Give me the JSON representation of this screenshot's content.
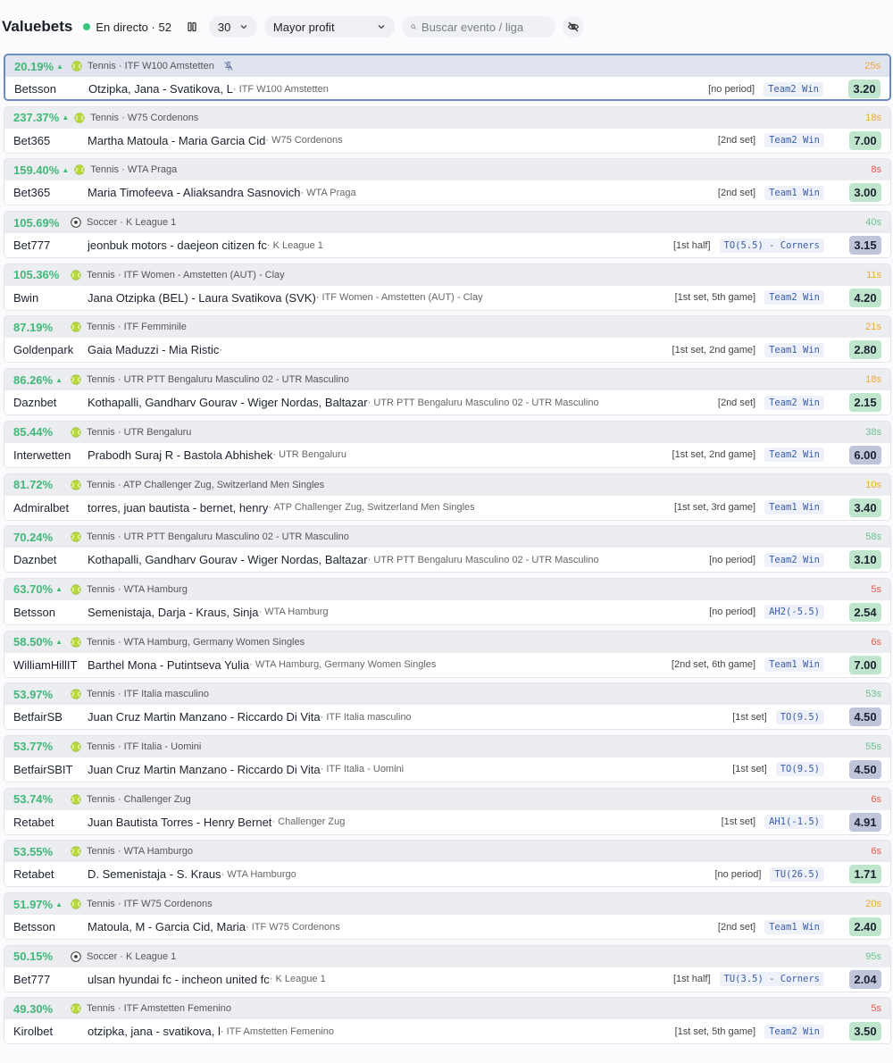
{
  "header": {
    "title": "Valuebets",
    "live_label": "En directo · 52",
    "count_value": "30",
    "sort_value": "Mayor profit",
    "search_placeholder": "Buscar evento / liga"
  },
  "colors": {
    "profit_green": "#41b877",
    "odds_green": "#bfe6cd",
    "odds_blue": "#bfc6dc",
    "age_orange": "#f0a83a",
    "age_red": "#e35a4e",
    "age_green": "#6cc28d"
  },
  "bets": [
    {
      "profit": "20.19%",
      "up": true,
      "sport_icon": "tennis-ball-icon",
      "meta": "Tennis · ITF W100 Amstetten",
      "pinned": true,
      "age": "25s",
      "age_color": "orange",
      "book": "Betsson",
      "event": "Otzipka, Jana - Svatikova, L",
      "league": " · ITF W100 Amstetten",
      "period": "[no period]",
      "market": "Team2 Win",
      "odds": "3.20",
      "odds_color": "green",
      "selected": true
    },
    {
      "profit": "237.37%",
      "up": true,
      "sport_icon": "tennis-ball-icon",
      "meta": "Tennis · W75 Cordenons",
      "pinned": false,
      "age": "18s",
      "age_color": "orange",
      "book": "Bet365",
      "event": "Martha Matoula - Maria Garcia Cid",
      "league": " · W75 Cordenons",
      "period": "[2nd set]",
      "market": "Team2 Win",
      "odds": "7.00",
      "odds_color": "green"
    },
    {
      "profit": "159.40%",
      "up": true,
      "sport_icon": "tennis-ball-icon",
      "meta": "Tennis · WTA Praga",
      "pinned": false,
      "age": "8s",
      "age_color": "red",
      "book": "Bet365",
      "event": "Maria Timofeeva - Aliaksandra Sasnovich",
      "league": " · WTA Praga",
      "period": "[2nd set]",
      "market": "Team1 Win",
      "odds": "3.00",
      "odds_color": "green"
    },
    {
      "profit": "105.69%",
      "up": false,
      "sport_icon": "soccer-ball-icon",
      "meta": "Soccer · K League 1",
      "pinned": false,
      "age": "40s",
      "age_color": "green",
      "book": "Bet777",
      "event": "jeonbuk motors - daejeon citizen fc",
      "league": " · K League 1",
      "period": "[1st half]",
      "market": "TO(5.5) - Corners",
      "odds": "3.15",
      "odds_color": "blue"
    },
    {
      "profit": "105.36%",
      "up": false,
      "sport_icon": "tennis-ball-icon",
      "meta": "Tennis · ITF Women - Amstetten (AUT) - Clay",
      "pinned": false,
      "age": "11s",
      "age_color": "orange",
      "book": "Bwin",
      "event": "Jana Otzipka (BEL) - Laura Svatikova (SVK)",
      "league": " · ITF Women - Amstetten (AUT) - Clay",
      "period": "[1st set, 5th game]",
      "market": "Team2 Win",
      "odds": "4.20",
      "odds_color": "green"
    },
    {
      "profit": "87.19%",
      "up": false,
      "sport_icon": "tennis-ball-icon",
      "meta": "Tennis · ITF Femminile",
      "pinned": false,
      "age": "21s",
      "age_color": "orange",
      "book": "Goldenpark",
      "event": "Gaia Maduzzi - Mia Ristic",
      "league": " · ",
      "period": "[1st set, 2nd game]",
      "market": "Team1 Win",
      "odds": "2.80",
      "odds_color": "green"
    },
    {
      "profit": "86.26%",
      "up": true,
      "sport_icon": "tennis-ball-icon",
      "meta": "Tennis · UTR PTT Bengaluru Masculino 02 - UTR Masculino",
      "pinned": false,
      "age": "18s",
      "age_color": "orange",
      "book": "Daznbet",
      "event": "Kothapalli, Gandharv Gourav - Wiger Nordas, Baltazar",
      "league": " · UTR PTT Bengaluru Masculino 02 - UTR Masculino",
      "period": "[2nd set]",
      "market": "Team2 Win",
      "odds": "2.15",
      "odds_color": "green"
    },
    {
      "profit": "85.44%",
      "up": false,
      "sport_icon": "tennis-ball-icon",
      "meta": "Tennis · UTR Bengaluru",
      "pinned": false,
      "age": "38s",
      "age_color": "green",
      "book": "Interwetten",
      "event": "Prabodh Suraj R - Bastola Abhishek",
      "league": " · UTR Bengaluru",
      "period": "[1st set, 2nd game]",
      "market": "Team2 Win",
      "odds": "6.00",
      "odds_color": "blue"
    },
    {
      "profit": "81.72%",
      "up": false,
      "sport_icon": "tennis-ball-icon",
      "meta": "Tennis · ATP Challenger Zug, Switzerland Men Singles",
      "pinned": false,
      "age": "10s",
      "age_color": "orange",
      "book": "Admiralbet",
      "event": "torres, juan bautista - bernet, henry",
      "league": " · ATP Challenger Zug, Switzerland Men Singles",
      "period": "[1st set, 3rd game]",
      "market": "Team1 Win",
      "odds": "3.40",
      "odds_color": "green"
    },
    {
      "profit": "70.24%",
      "up": false,
      "sport_icon": "tennis-ball-icon",
      "meta": "Tennis · UTR PTT Bengaluru Masculino 02 - UTR Masculino",
      "pinned": false,
      "age": "58s",
      "age_color": "green",
      "book": "Daznbet",
      "event": "Kothapalli, Gandharv Gourav - Wiger Nordas, Baltazar",
      "league": " · UTR PTT Bengaluru Masculino 02 - UTR Masculino",
      "period": "[no period]",
      "market": "Team2 Win",
      "odds": "3.10",
      "odds_color": "green"
    },
    {
      "profit": "63.70%",
      "up": true,
      "sport_icon": "tennis-ball-icon",
      "meta": "Tennis · WTA Hamburg",
      "pinned": false,
      "age": "5s",
      "age_color": "red",
      "book": "Betsson",
      "event": "Semenistaja, Darja - Kraus, Sinja",
      "league": " · WTA Hamburg",
      "period": "[no period]",
      "market": "AH2(-5.5)",
      "odds": "2.54",
      "odds_color": "green"
    },
    {
      "profit": "58.50%",
      "up": true,
      "sport_icon": "tennis-ball-icon",
      "meta": "Tennis · WTA Hamburg, Germany Women Singles",
      "pinned": false,
      "age": "6s",
      "age_color": "red",
      "book": "WilliamHillIT",
      "event": "Barthel Mona - Putintseva Yulia",
      "league": " · WTA Hamburg, Germany Women Singles",
      "period": "[2nd set, 6th game]",
      "market": "Team1 Win",
      "odds": "7.00",
      "odds_color": "green"
    },
    {
      "profit": "53.97%",
      "up": false,
      "sport_icon": "tennis-ball-icon",
      "meta": "Tennis · ITF Italia masculino",
      "pinned": false,
      "age": "53s",
      "age_color": "green",
      "book": "BetfairSB",
      "event": "Juan Cruz Martin Manzano - Riccardo Di Vita",
      "league": " · ITF Italia masculino",
      "period": "[1st set]",
      "market": "TO(9.5)",
      "odds": "4.50",
      "odds_color": "blue"
    },
    {
      "profit": "53.77%",
      "up": false,
      "sport_icon": "tennis-ball-icon",
      "meta": "Tennis · ITF Italia - Uomini",
      "pinned": false,
      "age": "55s",
      "age_color": "green",
      "book": "BetfairSBIT",
      "event": "Juan Cruz Martin Manzano - Riccardo Di Vita",
      "league": " · ITF Italia - Uomini",
      "period": "[1st set]",
      "market": "TO(9.5)",
      "odds": "4.50",
      "odds_color": "blue"
    },
    {
      "profit": "53.74%",
      "up": false,
      "sport_icon": "tennis-ball-icon",
      "meta": "Tennis · Challenger Zug",
      "pinned": false,
      "age": "6s",
      "age_color": "red",
      "book": "Retabet",
      "event": "Juan Bautista Torres - Henry Bernet",
      "league": " · Challenger Zug",
      "period": "[1st set]",
      "market": "AH1(-1.5)",
      "odds": "4.91",
      "odds_color": "blue"
    },
    {
      "profit": "53.55%",
      "up": false,
      "sport_icon": "tennis-ball-icon",
      "meta": "Tennis · WTA Hamburgo",
      "pinned": false,
      "age": "6s",
      "age_color": "red",
      "book": "Retabet",
      "event": "D. Semenistaja - S. Kraus",
      "league": " · WTA Hamburgo",
      "period": "[no period]",
      "market": "TU(26.5)",
      "odds": "1.71",
      "odds_color": "green"
    },
    {
      "profit": "51.97%",
      "up": true,
      "sport_icon": "tennis-ball-icon",
      "meta": "Tennis · ITF W75 Cordenons",
      "pinned": false,
      "age": "20s",
      "age_color": "orange",
      "book": "Betsson",
      "event": "Matoula, M - Garcia Cid, Maria",
      "league": " · ITF W75 Cordenons",
      "period": "[2nd set]",
      "market": "Team1 Win",
      "odds": "2.40",
      "odds_color": "green"
    },
    {
      "profit": "50.15%",
      "up": false,
      "sport_icon": "soccer-ball-icon",
      "meta": "Soccer · K League 1",
      "pinned": false,
      "age": "95s",
      "age_color": "green",
      "book": "Bet777",
      "event": "ulsan hyundai fc - incheon united fc",
      "league": " · K League 1",
      "period": "[1st half]",
      "market": "TU(3.5) - Corners",
      "odds": "2.04",
      "odds_color": "blue"
    },
    {
      "profit": "49.30%",
      "up": false,
      "sport_icon": "tennis-ball-icon",
      "meta": "Tennis · ITF Amstetten Femenino",
      "pinned": false,
      "age": "5s",
      "age_color": "red",
      "book": "Kirolbet",
      "event": "otzipka, jana - svatikova, l",
      "league": " · ITF Amstetten Femenino",
      "period": "[1st set, 5th game]",
      "market": "Team2 Win",
      "odds": "3.50",
      "odds_color": "green"
    }
  ]
}
